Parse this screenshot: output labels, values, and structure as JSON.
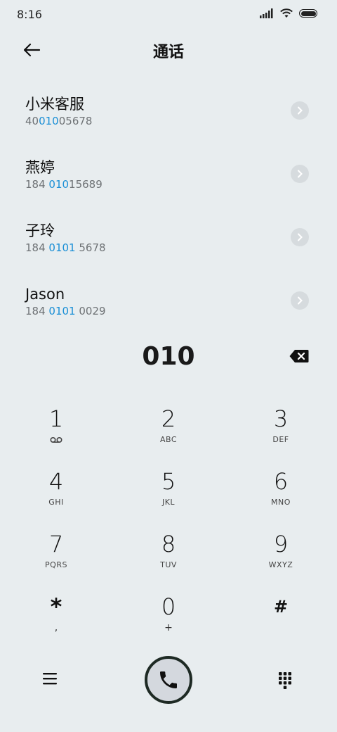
{
  "status": {
    "time": "8:16"
  },
  "header": {
    "title": "通话"
  },
  "contacts": [
    {
      "name": "小米客服",
      "number_pre": "40",
      "number_hl": "010",
      "number_post": "05678"
    },
    {
      "name": "燕婷",
      "number_pre": "184 ",
      "number_hl": "010",
      "number_post": "15689"
    },
    {
      "name": "子玲",
      "number_pre": "184 ",
      "number_hl": "0101",
      "number_post": " 5678"
    },
    {
      "name": "Jason",
      "number_pre": "184 ",
      "number_hl": "0101",
      "number_post": " 0029"
    }
  ],
  "dialer": {
    "value": "010"
  },
  "keys": [
    {
      "digit": "1",
      "letters": ""
    },
    {
      "digit": "2",
      "letters": "ABC"
    },
    {
      "digit": "3",
      "letters": "DEF"
    },
    {
      "digit": "4",
      "letters": "GHI"
    },
    {
      "digit": "5",
      "letters": "JKL"
    },
    {
      "digit": "6",
      "letters": "MNO"
    },
    {
      "digit": "7",
      "letters": "PQRS"
    },
    {
      "digit": "8",
      "letters": "TUV"
    },
    {
      "digit": "9",
      "letters": "WXYZ"
    },
    {
      "digit": "*",
      "letters": ","
    },
    {
      "digit": "0",
      "letters": "+"
    },
    {
      "digit": "#",
      "letters": ""
    }
  ],
  "colors": {
    "background": "#e8edef",
    "highlight": "#1a8fd6",
    "call_ring": "#1e2a24"
  },
  "icons": {
    "back": "arrow-left-icon",
    "chevron": "chevron-right-icon",
    "backspace": "backspace-icon",
    "voicemail": "voicemail-icon",
    "menu": "menu-icon",
    "call": "phone-icon",
    "keypad": "dialpad-icon"
  }
}
